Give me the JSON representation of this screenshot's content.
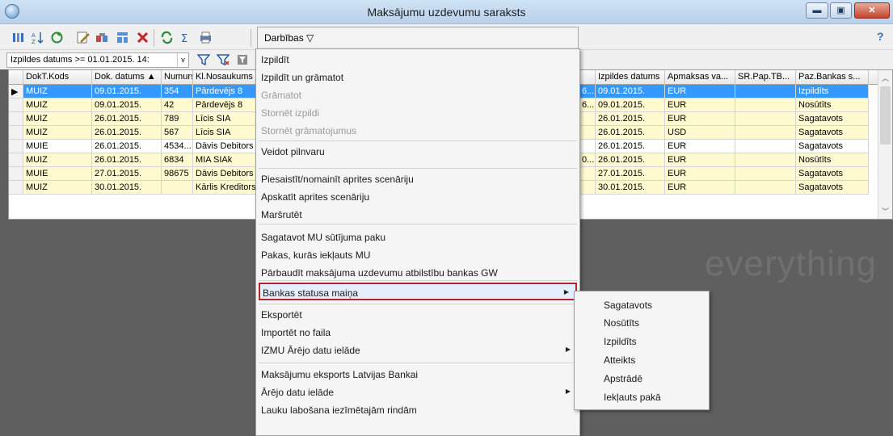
{
  "window": {
    "title": "Maksājumu uzdevumu saraksts",
    "min": "▬",
    "max": "▣",
    "close": "✕"
  },
  "toolbar": {
    "actions_label": "Darbības ▽",
    "help": "?",
    "icons": [
      "import-icon",
      "sort-icon",
      "refresh-icon",
      "edit-icon",
      "copy-icon",
      "properties-icon",
      "delete-icon",
      "sync-icon",
      "sum-icon",
      "print-icon"
    ]
  },
  "filter": {
    "value": "Izpildes datums >= 01.01.2015. 14:",
    "arrow": "v"
  },
  "grid": {
    "columns_left": [
      "DokT.Kods",
      "Dok. datums ▲",
      "Numurs",
      "Kl.Nosaukums"
    ],
    "columns_right": [
      "Izpildes datums",
      "Apmaksas va...",
      "SR.Pap.TB...",
      "Paz.Bankas s..."
    ],
    "rows": [
      {
        "kods": "MUIZ",
        "datums": "09.01.2015.",
        "numurs": "354",
        "nosaukums": "Pārdevējs 8",
        "trunc": "6...",
        "izpildes": "09.01.2015.",
        "valuta": "EUR",
        "sr": "",
        "statuss": "Izpildīts",
        "style": "selected"
      },
      {
        "kods": "MUIZ",
        "datums": "09.01.2015.",
        "numurs": "42",
        "nosaukums": "Pārdevējs 8",
        "trunc": "6...",
        "izpildes": "09.01.2015.",
        "valuta": "EUR",
        "sr": "",
        "statuss": "Nosūtīts",
        "style": "yellow"
      },
      {
        "kods": "MUIZ",
        "datums": "26.01.2015.",
        "numurs": "789",
        "nosaukums": "Līcis SIA",
        "trunc": "",
        "izpildes": "26.01.2015.",
        "valuta": "EUR",
        "sr": "",
        "statuss": "Sagatavots",
        "style": "yellow"
      },
      {
        "kods": "MUIZ",
        "datums": "26.01.2015.",
        "numurs": "567",
        "nosaukums": "Līcis SIA",
        "trunc": "",
        "izpildes": "26.01.2015.",
        "valuta": "USD",
        "sr": "",
        "statuss": "Sagatavots",
        "style": "yellow"
      },
      {
        "kods": "MUIE",
        "datums": "26.01.2015.",
        "numurs": "4534...",
        "nosaukums": "Dāvis Debitors",
        "trunc": "",
        "izpildes": "26.01.2015.",
        "valuta": "EUR",
        "sr": "",
        "statuss": "Sagatavots",
        "style": "white"
      },
      {
        "kods": "MUIZ",
        "datums": "26.01.2015.",
        "numurs": "6834",
        "nosaukums": "MIA SIAk",
        "trunc": "0...",
        "izpildes": "26.01.2015.",
        "valuta": "EUR",
        "sr": "",
        "statuss": "Nosūtīts",
        "style": "yellow"
      },
      {
        "kods": "MUIE",
        "datums": "27.01.2015.",
        "numurs": "98675",
        "nosaukums": "Dāvis Debitors",
        "trunc": "",
        "izpildes": "27.01.2015.",
        "valuta": "EUR",
        "sr": "",
        "statuss": "Sagatavots",
        "style": "yellow"
      },
      {
        "kods": "MUIZ",
        "datums": "30.01.2015.",
        "numurs": "",
        "nosaukums": "Kārlis Kreditors",
        "trunc": "",
        "izpildes": "30.01.2015.",
        "valuta": "EUR",
        "sr": "",
        "statuss": "Sagatavots",
        "style": "yellow"
      }
    ]
  },
  "watermark": "everything",
  "menu": {
    "items": [
      {
        "label": "Izpildīt",
        "disabled": false
      },
      {
        "label": "Izpildīt un grāmatot",
        "disabled": false
      },
      {
        "label": "Grāmatot",
        "disabled": true
      },
      {
        "label": "Stornēt izpildi",
        "disabled": true
      },
      {
        "label": "Stornēt grāmatojumus",
        "disabled": true
      },
      {
        "label": "Veidot pilnvaru",
        "disabled": false
      },
      {
        "label": "Piesaistīt/nomainīt aprites scenāriju",
        "disabled": false
      },
      {
        "label": "Apskatīt aprites scenāriju",
        "disabled": false
      },
      {
        "label": "Maršrutēt",
        "disabled": false
      },
      {
        "label": "Sagatavot MU sūtījuma paku",
        "disabled": false
      },
      {
        "label": "Pakas, kurās iekļauts MU",
        "disabled": false
      },
      {
        "label": "Pārbaudīt maksājuma uzdevumu atbilstību bankas GW",
        "disabled": false
      },
      {
        "label": "Bankas statusa maiņa",
        "disabled": false
      },
      {
        "label": "Eksportēt",
        "disabled": false
      },
      {
        "label": "Importēt no faila",
        "disabled": false
      },
      {
        "label": "IZMU Ārējo datu ielāde",
        "disabled": false
      },
      {
        "label": "Maksājumu eksports Latvijas Bankai",
        "disabled": false
      },
      {
        "label": "Ārējo datu ielāde",
        "disabled": false
      },
      {
        "label": "Lauku labošana iezīmētajām rindām",
        "disabled": false
      }
    ],
    "submenu_arrow": "▶"
  },
  "submenu": {
    "items": [
      "Sagatavots",
      "Nosūtīts",
      "Izpildīts",
      "Atteikts",
      "Apstrādē",
      "Iekļauts pakā"
    ]
  },
  "colors": {
    "selection": "#3399ff",
    "row_yellow": "#fffad0",
    "highlight_border": "#b0242d"
  }
}
